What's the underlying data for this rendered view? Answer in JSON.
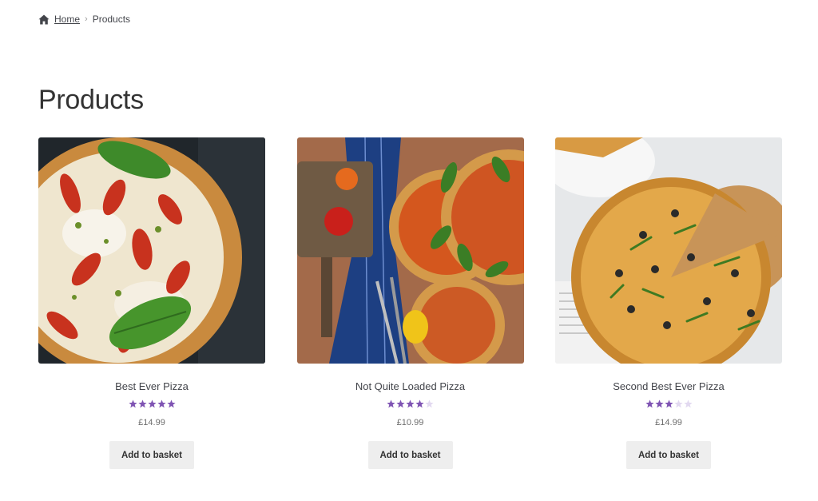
{
  "breadcrumb": {
    "home_label": "Home",
    "separator": "›",
    "current": "Products",
    "home_icon": "home-icon"
  },
  "page_title": "Products",
  "colors": {
    "star_filled": "#7f54b3",
    "star_empty": "#e2d9f0",
    "button_bg": "#eeeeee"
  },
  "products": [
    {
      "title": "Best Ever Pizza",
      "rating": 5,
      "rating_max": 5,
      "price": "£14.99",
      "button_label": "Add to basket"
    },
    {
      "title": "Not Quite Loaded Pizza",
      "rating": 4,
      "rating_max": 5,
      "price": "£10.99",
      "button_label": "Add to basket"
    },
    {
      "title": "Second Best Ever Pizza",
      "rating": 3,
      "rating_max": 5,
      "price": "£14.99",
      "button_label": "Add to basket"
    }
  ]
}
